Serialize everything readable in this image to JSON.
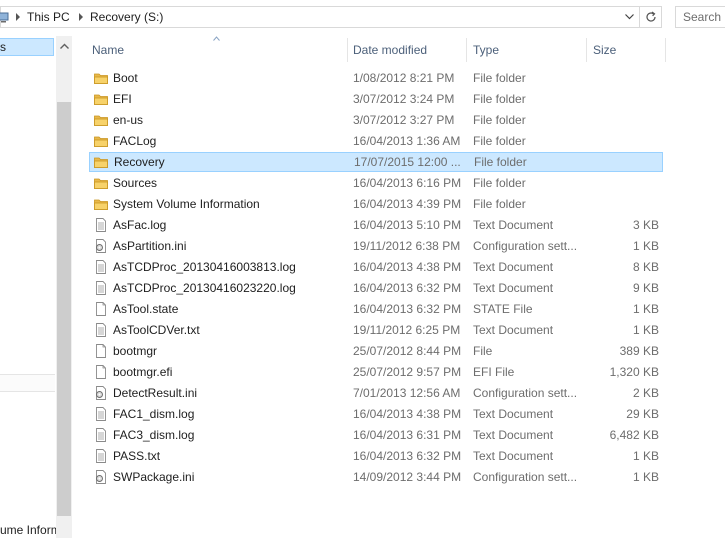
{
  "address": {
    "crumbs": [
      "This PC",
      "Recovery (S:)"
    ],
    "search_placeholder": "Search R"
  },
  "nav": {
    "selected_label": "s",
    "bottom_label": "ume Inform"
  },
  "columns": {
    "name": "Name",
    "date": "Date modified",
    "type": "Type",
    "size": "Size"
  },
  "files": [
    {
      "name": "Boot",
      "date": "1/08/2012 8:21 PM",
      "type": "File folder",
      "size": "",
      "icon": "folder-icon"
    },
    {
      "name": "EFI",
      "date": "3/07/2012 3:24 PM",
      "type": "File folder",
      "size": "",
      "icon": "folder-icon"
    },
    {
      "name": "en-us",
      "date": "3/07/2012 3:27 PM",
      "type": "File folder",
      "size": "",
      "icon": "folder-icon"
    },
    {
      "name": "FACLog",
      "date": "16/04/2013 1:36 AM",
      "type": "File folder",
      "size": "",
      "icon": "folder-icon"
    },
    {
      "name": "Recovery",
      "date": "17/07/2015 12:00 ...",
      "type": "File folder",
      "size": "",
      "icon": "folder-icon",
      "selected": true
    },
    {
      "name": "Sources",
      "date": "16/04/2013 6:16 PM",
      "type": "File folder",
      "size": "",
      "icon": "folder-icon"
    },
    {
      "name": "System Volume Information",
      "date": "16/04/2013 4:39 PM",
      "type": "File folder",
      "size": "",
      "icon": "folder-icon"
    },
    {
      "name": "AsFac.log",
      "date": "16/04/2013 5:10 PM",
      "type": "Text Document",
      "size": "3 KB",
      "icon": "text-file-icon"
    },
    {
      "name": "AsPartition.ini",
      "date": "19/11/2012 6:38 PM",
      "type": "Configuration sett...",
      "size": "1 KB",
      "icon": "config-file-icon"
    },
    {
      "name": "AsTCDProc_20130416003813.log",
      "date": "16/04/2013 4:38 PM",
      "type": "Text Document",
      "size": "8 KB",
      "icon": "text-file-icon"
    },
    {
      "name": "AsTCDProc_20130416023220.log",
      "date": "16/04/2013 6:32 PM",
      "type": "Text Document",
      "size": "9 KB",
      "icon": "text-file-icon"
    },
    {
      "name": "AsTool.state",
      "date": "16/04/2013 6:32 PM",
      "type": "STATE File",
      "size": "1 KB",
      "icon": "blank-file-icon"
    },
    {
      "name": "AsToolCDVer.txt",
      "date": "19/11/2012 6:25 PM",
      "type": "Text Document",
      "size": "1 KB",
      "icon": "text-file-icon"
    },
    {
      "name": "bootmgr",
      "date": "25/07/2012 8:44 PM",
      "type": "File",
      "size": "389 KB",
      "icon": "blank-file-icon"
    },
    {
      "name": "bootmgr.efi",
      "date": "25/07/2012 9:57 PM",
      "type": "EFI File",
      "size": "1,320 KB",
      "icon": "blank-file-icon"
    },
    {
      "name": "DetectResult.ini",
      "date": "7/01/2013 12:56 AM",
      "type": "Configuration sett...",
      "size": "2 KB",
      "icon": "config-file-icon"
    },
    {
      "name": "FAC1_dism.log",
      "date": "16/04/2013 4:38 PM",
      "type": "Text Document",
      "size": "29 KB",
      "icon": "text-file-icon"
    },
    {
      "name": "FAC3_dism.log",
      "date": "16/04/2013 6:31 PM",
      "type": "Text Document",
      "size": "6,482 KB",
      "icon": "text-file-icon"
    },
    {
      "name": "PASS.txt",
      "date": "16/04/2013 6:32 PM",
      "type": "Text Document",
      "size": "1 KB",
      "icon": "text-file-icon"
    },
    {
      "name": "SWPackage.ini",
      "date": "14/09/2012 3:44 PM",
      "type": "Configuration sett...",
      "size": "1 KB",
      "icon": "config-file-icon"
    }
  ]
}
